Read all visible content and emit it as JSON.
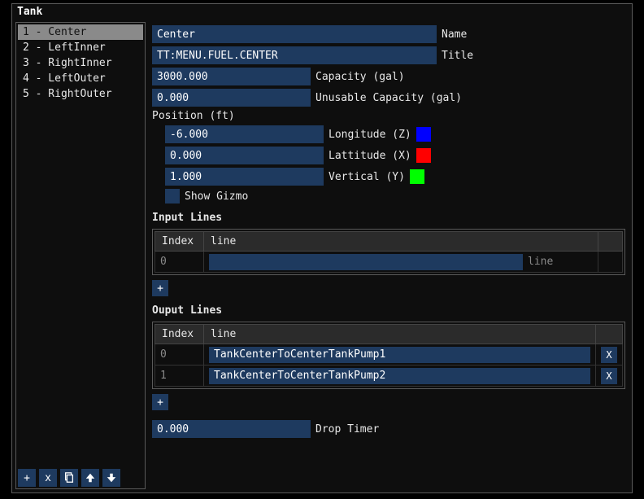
{
  "window": {
    "title": "Tank"
  },
  "sidebar": {
    "items": [
      {
        "label": "1 - Center",
        "selected": true
      },
      {
        "label": "2 - LeftInner",
        "selected": false
      },
      {
        "label": "3 - RightInner",
        "selected": false
      },
      {
        "label": "4 - LeftOuter",
        "selected": false
      },
      {
        "label": "5 - RightOuter",
        "selected": false
      }
    ],
    "buttons": {
      "add": "+",
      "remove": "x"
    }
  },
  "fields": {
    "name": {
      "value": "Center",
      "label": "Name"
    },
    "title": {
      "value": "TT:MENU.FUEL.CENTER",
      "label": "Title"
    },
    "capacity": {
      "value": "3000.000",
      "label": "Capacity (gal)"
    },
    "unusable": {
      "value": "0.000",
      "label": "Unusable Capacity (gal)"
    },
    "position_header": "Position (ft)",
    "longitude": {
      "value": "-6.000",
      "label": "Longitude (Z)",
      "color": "#0000ff"
    },
    "lattitude": {
      "value": "0.000",
      "label": "Lattitude (X)",
      "color": "#ff0000"
    },
    "vertical": {
      "value": "1.000",
      "label": "Vertical (Y)",
      "color": "#00ff00"
    },
    "show_gizmo": {
      "label": "Show Gizmo",
      "checked": false
    },
    "drop_timer": {
      "value": "0.000",
      "label": "Drop Timer"
    }
  },
  "input_lines": {
    "title": "Input Lines",
    "headers": {
      "index": "Index",
      "line": "line"
    },
    "rows": [
      {
        "index": "0",
        "value": "",
        "rowlabel": "line"
      }
    ],
    "add": "+"
  },
  "output_lines": {
    "title": "Ouput Lines",
    "headers": {
      "index": "Index",
      "line": "line"
    },
    "rows": [
      {
        "index": "0",
        "value": "TankCenterToCenterTankPump1",
        "x": "X"
      },
      {
        "index": "1",
        "value": "TankCenterToCenterTankPump2",
        "x": "X"
      }
    ],
    "add": "+"
  }
}
